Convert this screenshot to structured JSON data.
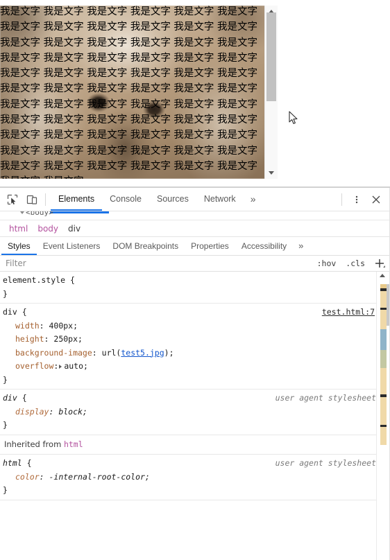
{
  "page": {
    "content_text": "我是文字 我是文字 我是文字 我是文字 我是文字 我是文字 我是文字 我是文字 我是文字 我是文字 我是文字 我是文字 我是文字 我是文字 我是文字 我是文字 我是文字 我是文字 我是文字 我是文字 我是文字 我是文字 我是文字 我是文字 我是文字 我是文字 我是文字 我是文字 我是文字 我是文字 我是文字 我是文字 我是文字 我是文字 我是文字 我是文字 我是文字 我是文字 我是文字 我是文字 我是文字 我是文字 我是文字 我是文字 我是文字 我是文字 我是文字 我是文字 我是文字 我是文字 我是文字 我是文字 我是文字 我是文字 我是文字 我是文字 我是文字 我是文字 我是文字 我是文字 我是文字 我是文字 我是文字 我是文字 我是文字 我是文字 我是文字 我是文字",
    "scrollbar": {
      "up_arrow": "scroll-up-arrow",
      "down_arrow": "scroll-down-arrow"
    },
    "cursor": "mouse-pointer"
  },
  "devtools": {
    "toolbar": {
      "inspect_icon": "inspect-element-icon",
      "device_icon": "device-toolbar-icon",
      "more_tabs": "»",
      "kebab_icon": "more-options-icon",
      "close_icon": "close-icon",
      "tabs": [
        {
          "label": "Elements",
          "active": true
        },
        {
          "label": "Console",
          "active": false
        },
        {
          "label": "Sources",
          "active": false
        },
        {
          "label": "Network",
          "active": false
        }
      ]
    },
    "dom_tree": {
      "visible_node": "<body>"
    },
    "breadcrumb": [
      {
        "label": "html",
        "style": "pink"
      },
      {
        "label": "body",
        "style": "pink"
      },
      {
        "label": "div",
        "style": "plain"
      }
    ],
    "sidebar_tabs": [
      {
        "label": "Styles",
        "active": true
      },
      {
        "label": "Event Listeners",
        "active": false
      },
      {
        "label": "DOM Breakpoints",
        "active": false
      },
      {
        "label": "Properties",
        "active": false
      },
      {
        "label": "Accessibility",
        "active": false
      }
    ],
    "sidebar_more": "»",
    "filter_bar": {
      "placeholder": "Filter",
      "value": "",
      "hov_label": ":hov",
      "cls_label": ".cls",
      "new_rule_icon": "plus-icon"
    },
    "styles": {
      "rules": [
        {
          "selector": "element.style",
          "source": "",
          "source_kind": "none",
          "open_brace": "{",
          "close_brace": "}",
          "properties": []
        },
        {
          "selector": "div",
          "source": "test.html:7",
          "source_kind": "link",
          "open_brace": "{",
          "close_brace": "}",
          "properties": [
            {
              "name": "width",
              "value": "400px",
              "has_expand": false,
              "link": ""
            },
            {
              "name": "height",
              "value": "250px",
              "has_expand": false,
              "link": ""
            },
            {
              "name": "background-image",
              "value": "url(test5.jpg);",
              "has_expand": false,
              "link": "test5.jpg"
            },
            {
              "name": "overflow",
              "value": "auto",
              "has_expand": true,
              "link": ""
            }
          ]
        },
        {
          "selector": "div",
          "source": "user agent stylesheet",
          "source_kind": "ua",
          "open_brace": "{",
          "close_brace": "}",
          "properties": [
            {
              "name": "display",
              "value": "block",
              "has_expand": false,
              "link": ""
            }
          ]
        }
      ],
      "inherited_label": "Inherited from",
      "inherited_from_tag": "html",
      "inherited_rules": [
        {
          "selector": "html",
          "source": "user agent stylesheet",
          "source_kind": "ua",
          "open_brace": "{",
          "close_brace": "}",
          "properties": [
            {
              "name": "color",
              "value": "-internal-root-color",
              "has_expand": false,
              "link": ""
            }
          ]
        }
      ]
    },
    "colors": {
      "accent": "#1a73e8",
      "property_name": "#a5602e",
      "link": "#1155cc",
      "tag_pink": "#b3519e"
    }
  }
}
